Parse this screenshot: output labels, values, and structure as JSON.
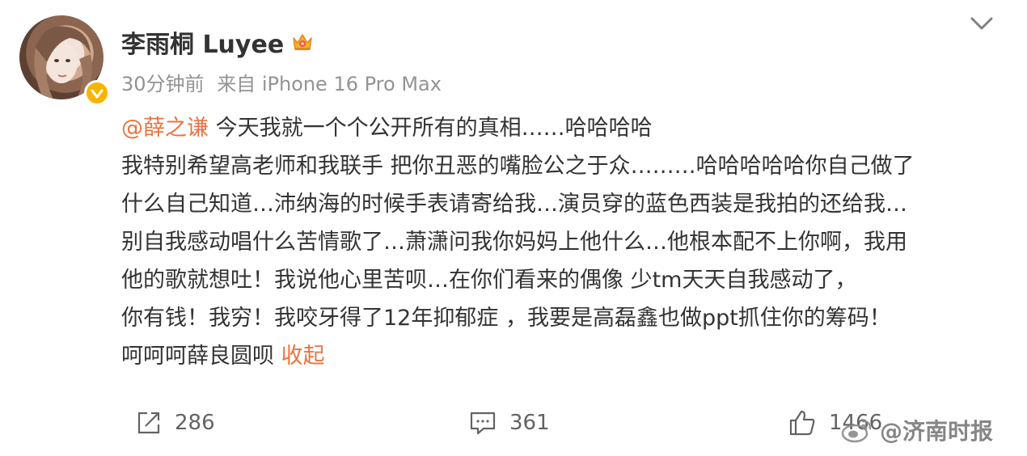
{
  "post": {
    "author": "李雨桐 Luyee",
    "time": "30分钟前",
    "source": "来自 iPhone 16 Pro Max",
    "mention": "@薛之谦",
    "lines": [
      " 今天我就一个个公开所有的真相……哈哈哈哈",
      "我特别希望高老师和我联手 把你丑恶的嘴脸公之于众………哈哈哈哈哈你自己做了",
      "什么自己知道…沛纳海的时候手表请寄给我…演员穿的蓝色西装是我拍的还给我…",
      "别自我感动唱什么苦情歌了…萧潇问我你妈妈上他什么…他根本配不上你啊，我用",
      "他的歌就想吐！我说他心里苦呗…在你们看来的偶像 少tm天天自我感动了，",
      "你有钱！我穷！我咬牙得了12年抑郁症 ，我要是高磊鑫也做ppt抓住你的筹码！",
      "呵呵呵薛良圆呗 "
    ],
    "collapse_label": "收起"
  },
  "actions": {
    "repost_count": "286",
    "comment_count": "361",
    "like_count": "1466"
  },
  "watermark": {
    "text": "@济南时报"
  },
  "colors": {
    "accent": "#eb7340",
    "verified": "#f7b500",
    "text": "#333333",
    "meta": "#939393"
  },
  "icons": {
    "verified": "verified-badge-icon",
    "crown": "crown-icon",
    "menu": "chevron-down-icon",
    "repost": "repost-icon",
    "comment": "comment-icon",
    "like": "thumbs-up-icon",
    "watermark": "weibo-logo-icon"
  }
}
